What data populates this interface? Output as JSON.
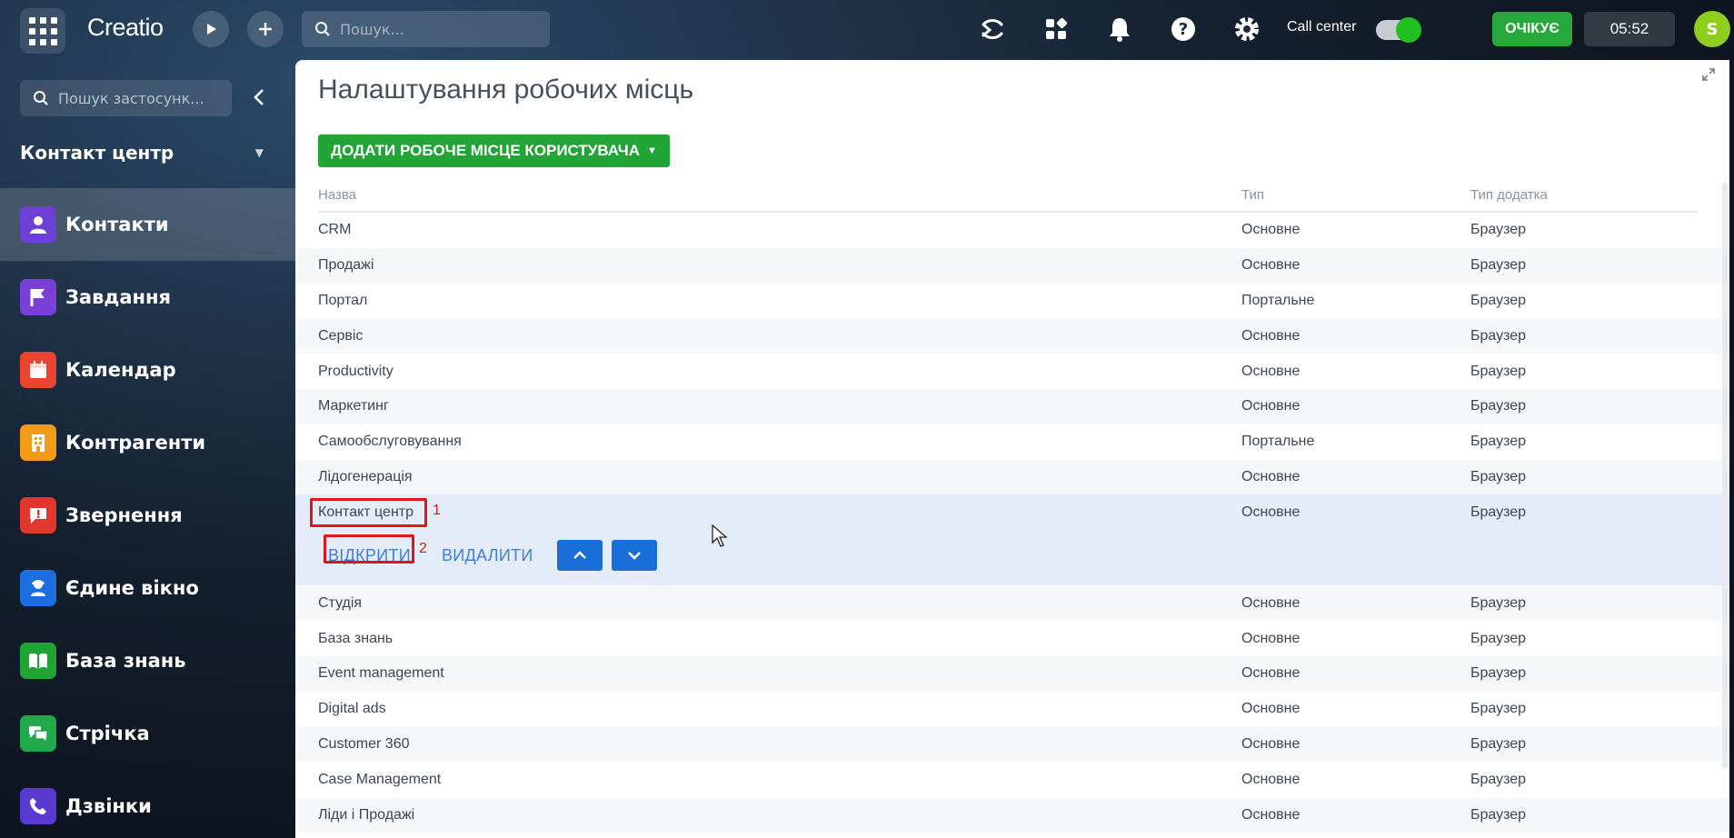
{
  "topbar": {
    "logo": "Creatio",
    "search_placeholder": "Пошук...",
    "call_center_label": "Call center",
    "status_label": "ОЧІКУЄ",
    "timer": "05:52",
    "avatar_initial": "S"
  },
  "sidebar": {
    "search_placeholder": "Пошук застосунк...",
    "workspace": "Контакт центр",
    "items": [
      {
        "label": "Контакти",
        "icon": "contact-icon",
        "color": "#6c3fd6"
      },
      {
        "label": "Завдання",
        "icon": "flag-icon",
        "color": "#7b3fd8"
      },
      {
        "label": "Календар",
        "icon": "calendar-icon",
        "color": "#e8442f"
      },
      {
        "label": "Контрагенти",
        "icon": "building-icon",
        "color": "#f29b16"
      },
      {
        "label": "Звернення",
        "icon": "alert-chat-icon",
        "color": "#e0382e"
      },
      {
        "label": "Єдине вікно",
        "icon": "agent-icon",
        "color": "#1d6fe0"
      },
      {
        "label": "База знань",
        "icon": "book-icon",
        "color": "#22a335"
      },
      {
        "label": "Стрічка",
        "icon": "chat-icon",
        "color": "#20a84a"
      },
      {
        "label": "Дзвінки",
        "icon": "phone-icon",
        "color": "#5b3ad1"
      }
    ]
  },
  "main": {
    "title": "Налаштування робочих місць",
    "add_button": "ДОДАТИ РОБОЧЕ МІСЦЕ КОРИСТУВАЧА",
    "columns": [
      "Назва",
      "Тип",
      "Тип додатка"
    ],
    "rows": [
      [
        "CRM",
        "Основне",
        "Браузер"
      ],
      [
        "Продажі",
        "Основне",
        "Браузер"
      ],
      [
        "Портал",
        "Портальне",
        "Браузер"
      ],
      [
        "Сервіс",
        "Основне",
        "Браузер"
      ],
      [
        "Productivity",
        "Основне",
        "Браузер"
      ],
      [
        "Маркетинг",
        "Основне",
        "Браузер"
      ],
      [
        "Самообслуговування",
        "Портальне",
        "Браузер"
      ],
      [
        "Лідогенерація",
        "Основне",
        "Браузер"
      ]
    ],
    "selected_row": [
      "Контакт центр",
      "Основне",
      "Браузер"
    ],
    "open_label": "ВІДКРИТИ",
    "delete_label": "ВИДАЛИТИ",
    "marker_1": "1",
    "marker_2": "2",
    "rows_after": [
      [
        "Студія",
        "Основне",
        "Браузер"
      ],
      [
        "База знань",
        "Основне",
        "Браузер"
      ],
      [
        "Event management",
        "Основне",
        "Браузер"
      ],
      [
        "Digital ads",
        "Основне",
        "Браузер"
      ],
      [
        "Customer 360",
        "Основне",
        "Браузер"
      ],
      [
        "Case Management",
        "Основне",
        "Браузер"
      ],
      [
        "Ліди і Продажі",
        "Основне",
        "Браузер"
      ]
    ]
  },
  "colors": {
    "accent_green": "#23a436",
    "accent_blue": "#1a6ed8",
    "highlight_red": "#e3131b"
  }
}
